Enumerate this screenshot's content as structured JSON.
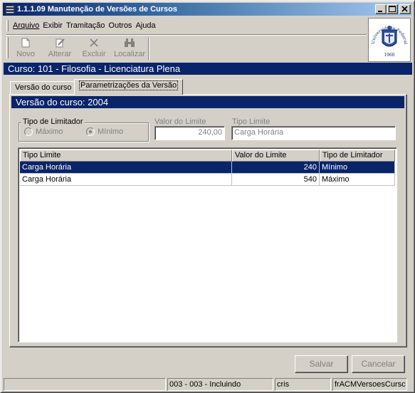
{
  "window": {
    "title": "1.1.1.09 Manutenção de Versões de Cursos"
  },
  "menu": [
    {
      "label": "Arquivo"
    },
    {
      "label": "Exibir"
    },
    {
      "label": "Tramitação"
    },
    {
      "label": "Outros"
    },
    {
      "label": "Ajuda"
    }
  ],
  "toolbar": {
    "novo": "Novo",
    "alterar": "Alterar",
    "excluir": "Excluir",
    "localizar": "Localizar"
  },
  "logo": {
    "text": "Universidade Federal de Santa Maria",
    "year": "1960"
  },
  "course_bar": "Curso: 101 - Filosofia - Licenciatura Plena",
  "tabs": [
    {
      "label": "Versão do curso"
    },
    {
      "label": "Parametrizações da Versão"
    }
  ],
  "version_bar": "Versão do curso: 2004",
  "form": {
    "tipo_limitador_label": "Tipo de Limitador",
    "radio_maximo": "Máximo",
    "radio_minimo": "Mínimo",
    "valor_limite_label": "Valor do Limite",
    "valor_limite_value": "240,00",
    "tipo_limite_label": "Tipo Limite",
    "tipo_limite_value": "Carga Horária"
  },
  "grid": {
    "headers": [
      "Tipo Limite",
      "Valor do Limite",
      "Tipo de Limitador"
    ],
    "rows": [
      {
        "tipo": "Carga Horária",
        "valor": "240",
        "limitador": "Mínimo"
      },
      {
        "tipo": "Carga Horária",
        "valor": "540",
        "limitador": "Máximo"
      }
    ]
  },
  "buttons": {
    "salvar": "Salvar",
    "cancelar": "Cancelar"
  },
  "status": {
    "mode": "003 - 003 - Incluindo",
    "user": "cris",
    "form_name": "frACMVersoesCursc"
  },
  "colors": {
    "accent": "#0a246a",
    "face": "#d4d0c8"
  }
}
